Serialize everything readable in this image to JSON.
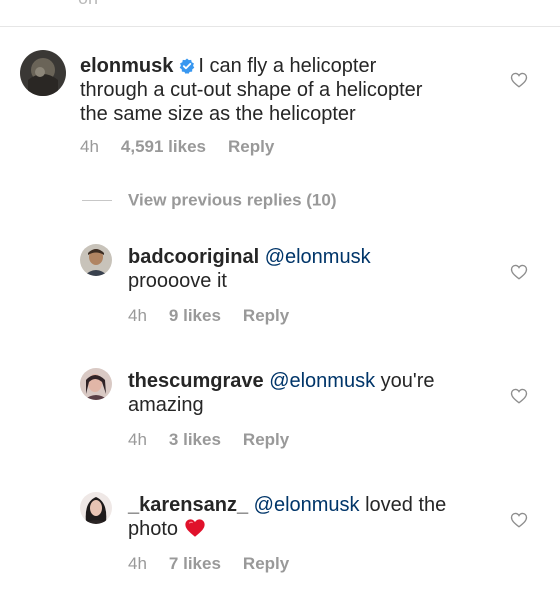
{
  "top_fragment": "on",
  "main_comment": {
    "username": "elonmusk",
    "verified": true,
    "text_line1": "I can fly a helicopter",
    "text_line2": "through a cut-out shape of a helicopter",
    "text_line3": "the same size as the helicopter",
    "time": "4h",
    "likes": "4,591 likes",
    "reply": "Reply"
  },
  "view_previous": "View previous replies (10)",
  "replies": [
    {
      "username": "badcooriginal",
      "mention": "@elonmusk",
      "text_line1": "",
      "text_line2": "proooove it",
      "time": "4h",
      "likes": "9 likes",
      "reply": "Reply"
    },
    {
      "username": "thescumgrave",
      "mention": "@elonmusk",
      "text_line1": "you're",
      "text_line2": "amazing",
      "time": "4h",
      "likes": "3 likes",
      "reply": "Reply"
    },
    {
      "username": "_karensanz_",
      "mention": "@elonmusk",
      "text_line1": "loved the",
      "text_line2": "photo",
      "emoji": "❤️",
      "time": "4h",
      "likes": "7 likes",
      "reply": "Reply"
    }
  ],
  "colors": {
    "text": "#262626",
    "meta": "#999999",
    "mention": "#003569",
    "verified": "#3897f0",
    "heart_outline": "#8e8e8e"
  },
  "icons": {
    "verified": "verified-badge-icon",
    "like": "heart-outline-icon",
    "emoji": "red-heart-emoji"
  }
}
